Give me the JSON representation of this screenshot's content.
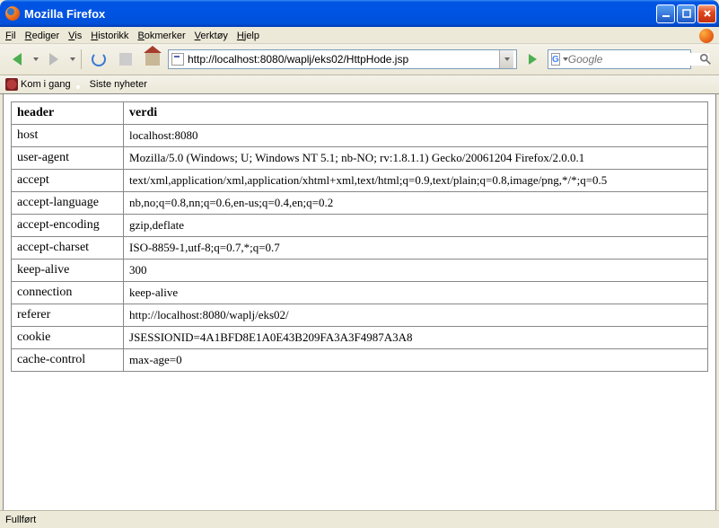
{
  "window": {
    "title": "Mozilla Firefox"
  },
  "menus": {
    "file": "Fil",
    "edit": "Rediger",
    "view": "Vis",
    "history": "Historikk",
    "bookmarks": "Bokmerker",
    "tools": "Verktøy",
    "help": "Hjelp"
  },
  "url": "http://localhost:8080/waplj/eks02/HttpHode.jsp",
  "search": {
    "placeholder": "Google"
  },
  "bookmarks": {
    "item1": "Kom i gang",
    "item2": "Siste nyheter"
  },
  "table": {
    "col1": "header",
    "col2": "verdi",
    "rows": [
      {
        "h": "host",
        "v": "localhost:8080"
      },
      {
        "h": "user-agent",
        "v": "Mozilla/5.0 (Windows; U; Windows NT 5.1; nb-NO; rv:1.8.1.1) Gecko/20061204 Firefox/2.0.0.1"
      },
      {
        "h": "accept",
        "v": "text/xml,application/xml,application/xhtml+xml,text/html;q=0.9,text/plain;q=0.8,image/png,*/*;q=0.5"
      },
      {
        "h": "accept-language",
        "v": "nb,no;q=0.8,nn;q=0.6,en-us;q=0.4,en;q=0.2"
      },
      {
        "h": "accept-encoding",
        "v": "gzip,deflate"
      },
      {
        "h": "accept-charset",
        "v": "ISO-8859-1,utf-8;q=0.7,*;q=0.7"
      },
      {
        "h": "keep-alive",
        "v": "300"
      },
      {
        "h": "connection",
        "v": "keep-alive"
      },
      {
        "h": "referer",
        "v": "http://localhost:8080/waplj/eks02/"
      },
      {
        "h": "cookie",
        "v": "JSESSIONID=4A1BFD8E1A0E43B209FA3A3F4987A3A8"
      },
      {
        "h": "cache-control",
        "v": "max-age=0"
      }
    ]
  },
  "status": "Fullført"
}
